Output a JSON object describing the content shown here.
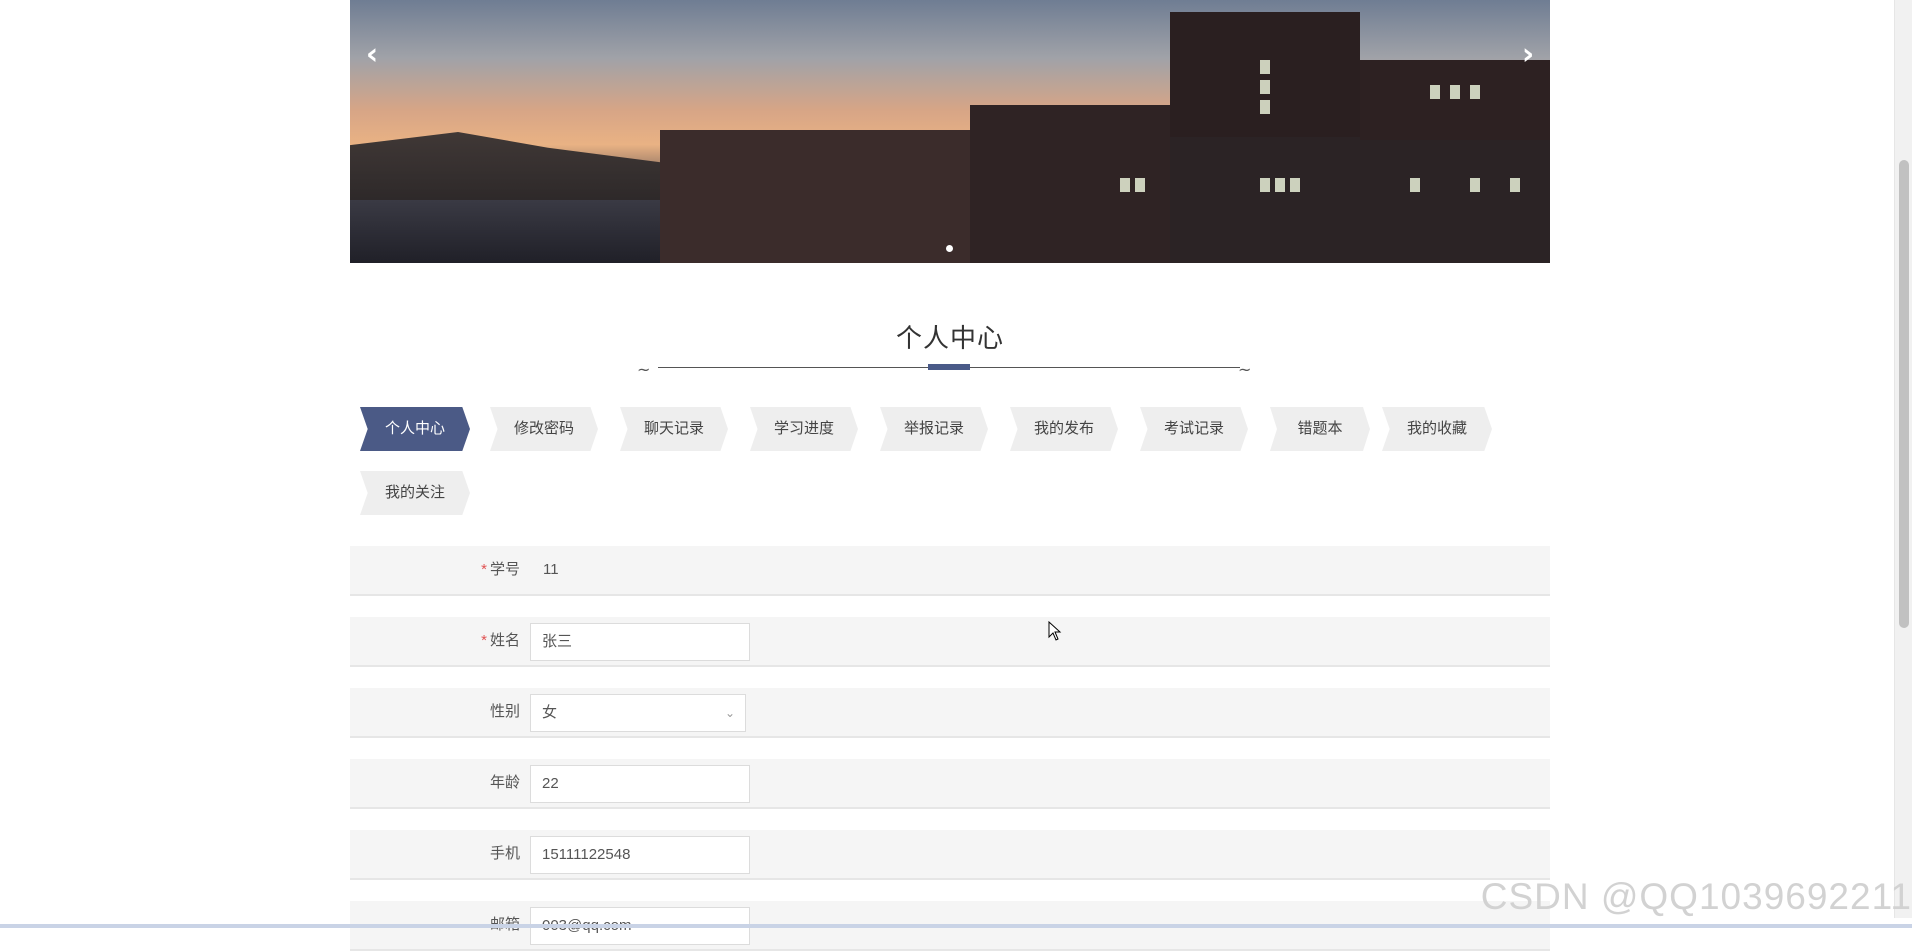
{
  "banner": {
    "prev_icon": "chevron-left-icon",
    "next_icon": "chevron-right-icon",
    "prev_glyph": "‹",
    "next_glyph": "›"
  },
  "page": {
    "title": "个人中心"
  },
  "tabs": [
    {
      "label": "个人中心",
      "active": true
    },
    {
      "label": "修改密码",
      "active": false
    },
    {
      "label": "聊天记录",
      "active": false
    },
    {
      "label": "学习进度",
      "active": false
    },
    {
      "label": "举报记录",
      "active": false
    },
    {
      "label": "我的发布",
      "active": false
    },
    {
      "label": "考试记录",
      "active": false
    },
    {
      "label": "错题本",
      "active": false
    },
    {
      "label": "我的收藏",
      "active": false
    },
    {
      "label": "我的关注",
      "active": false
    }
  ],
  "form": {
    "student_id": {
      "label": "学号",
      "required": "*",
      "value": "11"
    },
    "name": {
      "label": "姓名",
      "required": "*",
      "value": "张三"
    },
    "gender": {
      "label": "性别",
      "value": "女"
    },
    "age": {
      "label": "年龄",
      "value": "22"
    },
    "phone": {
      "label": "手机",
      "value": "15111122548"
    },
    "email": {
      "label": "邮箱",
      "value": "003@qq.com"
    }
  },
  "watermark": "CSDN @QQ1039692211",
  "colors": {
    "accent": "#4b5a86",
    "required": "#e05252"
  }
}
